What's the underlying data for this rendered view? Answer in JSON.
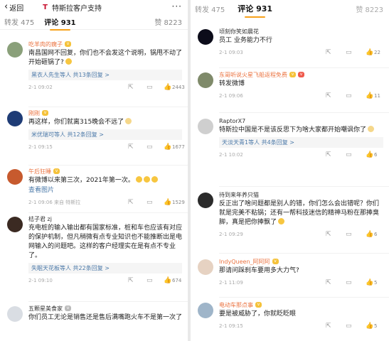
{
  "left": {
    "topbar": {
      "back_label": "返回",
      "title": "特斯拉客户支持",
      "more": "···"
    },
    "tabs": {
      "repost": "转发 475",
      "comment": "评论 931",
      "likes": "赞 8223"
    },
    "comments": [
      {
        "user": "吃羊肉的瘸子",
        "text": "南昌国网不回复，你们也不会发这个说明，锅甩不动了开始砸锅了?",
        "replies": "黑衣人先生等人  共13条回复 >",
        "time": "2-1 09:02",
        "likes": "2443"
      },
      {
        "user": "刚刚",
        "text": "再这样，你们就离315晚会不远了",
        "replies": "米优瑞可等人  共12条回复 >",
        "time": "2-1 09:15",
        "likes": "1677"
      },
      {
        "user": "午后狂睡",
        "text": "有微博以来第三次，2021年第一次。",
        "replies": "查看图片",
        "time": "2-1 09:06 来自 特斯拉",
        "likes": "1529"
      },
      {
        "user": "桔子君 zj",
        "text": "充电桩的输入输出都有国家标准，桩和车也应该有对应的保护机制，但凡稍微有点专业知识也不能推断出是电网输入的问题吧。这样的客户经理实在是有点不专业了。",
        "replies": "失眠天花板等人  共22条回复 >",
        "time": "2-1 09:10",
        "likes": "674"
      },
      {
        "user": "五颗星美食家",
        "text": "你们员工无论是销售还是售后满嘴跑火车不是第一次了",
        "replies": "",
        "time": "",
        "likes": ""
      }
    ]
  },
  "right": {
    "tabs": {
      "repost": "转发 475",
      "comment": "评论 931",
      "likes": "赞 8223"
    },
    "comments": [
      {
        "user": "顷刻你笑如晨花",
        "text": "员工 业务能力不行",
        "replies": "",
        "time": "2-1 09:03",
        "likes": "22"
      },
      {
        "user": "东哥听说火星飞船返程免费",
        "text": "转发微博",
        "replies": "",
        "time": "2-1 09:06",
        "likes": "11"
      },
      {
        "user": "RaptorX7",
        "text": "特斯拉中国是不是该反思下为啥大家都开始嘲讽你了",
        "replies": "天淡天青1等人  共4条回复 >",
        "time": "2-1 10:02",
        "likes": "6"
      },
      {
        "user": "待到来年养只猫",
        "text": "反正出了啥问题都是别人的错，你们怎么会出错呢？你们就是完美不粘锅；还有一帮科技迷信的精神马粉在那捧臭脚，真是把你捧飘了",
        "replies": "",
        "time": "2-1 09:29",
        "likes": "6"
      },
      {
        "user": "IndyQueen_阿阿阿",
        "text": "那请问踩刹车要用多大力气?",
        "replies": "",
        "time": "2-1 11:09",
        "likes": "5"
      },
      {
        "user": "电动车那点事",
        "text": "要是被威胁了，你就眨眨眼",
        "replies": "",
        "time": "2-1 09:15",
        "likes": "5"
      }
    ]
  }
}
